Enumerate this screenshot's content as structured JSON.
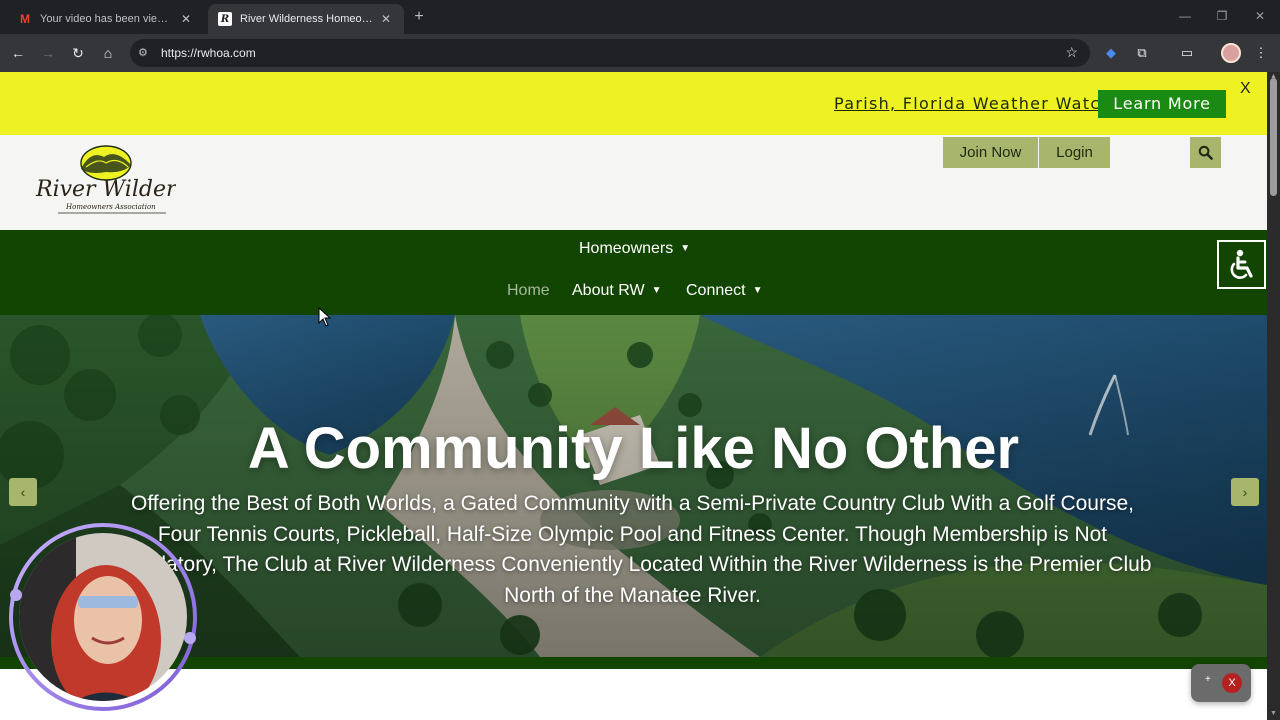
{
  "browser": {
    "tabs": [
      {
        "title": "Your video has been viewed: N",
        "icon": "gmail-icon",
        "active": false
      },
      {
        "title": "River Wilderness Homeowners",
        "icon": "rw-favicon",
        "active": true
      }
    ],
    "url": "https://rwhoa.com",
    "icons": {
      "close": "✕",
      "new_tab": "+",
      "back": "←",
      "forward": "→",
      "reload": "↻",
      "home": "⌂",
      "site_info": "⚙",
      "star": "☆",
      "minimize": "—",
      "maximize": "❐",
      "window_close": "✕",
      "extensions": "⧉",
      "media": "▭",
      "menu": "⋮",
      "bookmark_ext": "◆"
    }
  },
  "promo": {
    "link": "Parish, Florida Weather Watch",
    "cta": "Learn More",
    "close": "X",
    "colors": {
      "background": "#eef122",
      "cta": "#1a8a12"
    }
  },
  "header": {
    "logo_main": "River Wilderness",
    "logo_sub": "Homeowners Association",
    "join": "Join Now",
    "login": "Login",
    "button_color": "#a7b56d"
  },
  "nav": {
    "row1": [
      {
        "label": "Homeowners",
        "chevron": "▼"
      }
    ],
    "row2": [
      {
        "label": "Home",
        "chevron": ""
      },
      {
        "label": "About RW",
        "chevron": "▼"
      },
      {
        "label": "Connect",
        "chevron": "▼"
      }
    ],
    "background": "#124502"
  },
  "hero": {
    "headline": "A Community Like No Other",
    "subtext": "Offering the Best of Both Worlds, a Gated Community with a Semi-Private Country Club With a Golf Course, Four Tennis Courts, Pickleball, Half-Size Olympic Pool and Fitness Center. Though Membership is Not Mandatory, The Club at River Wilderness Conveniently Located Within the River Wilderness is the Premier Club North of the Manatee River.",
    "prev": "‹",
    "next": "›"
  },
  "widget": {
    "plus": "+",
    "close": "X"
  }
}
